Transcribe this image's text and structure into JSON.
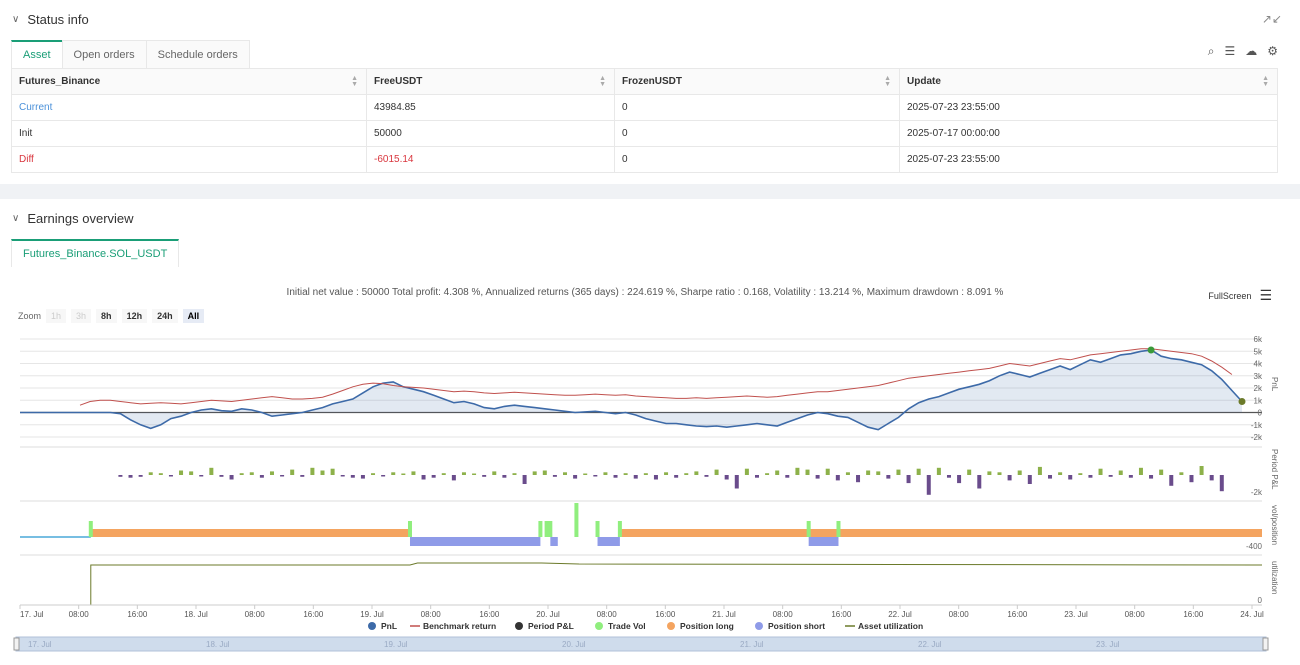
{
  "status": {
    "title": "Status info",
    "tabs": [
      "Asset",
      "Open orders",
      "Schedule orders"
    ],
    "columns": [
      "Futures_Binance",
      "FreeUSDT",
      "FrozenUSDT",
      "Update"
    ],
    "rows": [
      {
        "name": "Current",
        "free": "43984.85",
        "frozen": "0",
        "update": "2025-07-23 23:55:00"
      },
      {
        "name": "Init",
        "free": "50000",
        "frozen": "0",
        "update": "2025-07-17 00:00:00"
      },
      {
        "name": "Diff",
        "free": "-6015.14",
        "frozen": "0",
        "update": "2025-07-23 23:55:00"
      }
    ]
  },
  "earnings": {
    "title": "Earnings overview",
    "tab": "Futures_Binance.SOL_USDT",
    "summary": "Initial net value : 50000 Total profit: 4.308 %, Annualized returns (365 days) : 224.619 %, Sharpe ratio : 0.168, Volatility : 13.214 %, Maximum drawdown : 8.091 %",
    "fullscreen": "FullScreen",
    "zoom_label": "Zoom",
    "zoom_buttons": [
      "1h",
      "3h",
      "8h",
      "12h",
      "24h",
      "All"
    ]
  },
  "chart_data": {
    "type": "line",
    "y_axis_pnl": {
      "label": "PnL",
      "ticks": [
        "6k",
        "5k",
        "4k",
        "3k",
        "2k",
        "1k",
        "0",
        "-1k",
        "-2k"
      ]
    },
    "y_axis_period": {
      "label": "Period P&L",
      "ticks": [
        "-2k"
      ]
    },
    "y_axis_vol": {
      "label": "vol/position",
      "ticks": [
        "-400"
      ]
    },
    "y_axis_util": {
      "label": "utilization",
      "ticks": [
        "0"
      ]
    },
    "x_ticks": [
      "17. Jul",
      "08:00",
      "16:00",
      "18. Jul",
      "08:00",
      "16:00",
      "19. Jul",
      "08:00",
      "16:00",
      "20. Jul",
      "08:00",
      "16:00",
      "21. Jul",
      "08:00",
      "16:00",
      "22. Jul",
      "08:00",
      "16:00",
      "23. Jul",
      "08:00",
      "16:00",
      "24. Jul"
    ],
    "navigator_ticks": [
      "17. Jul",
      "18. Jul",
      "19. Jul",
      "20. Jul",
      "21. Jul",
      "22. Jul",
      "23. Jul"
    ],
    "legend": [
      {
        "name": "PnL",
        "color": "#3d6aa8"
      },
      {
        "name": "Benchmark return",
        "color": "#c0504d"
      },
      {
        "name": "Period P&L",
        "color": "#333333"
      },
      {
        "name": "Trade Vol",
        "color": "#90ee7e"
      },
      {
        "name": "Position long",
        "color": "#f4a460"
      },
      {
        "name": "Position short",
        "color": "#8f9be8"
      },
      {
        "name": "Asset utilization",
        "color": "#6b7a2a"
      }
    ],
    "pnl": [
      0,
      0,
      0,
      0,
      -100,
      -600,
      -1000,
      -1300,
      -1000,
      -500,
      -300,
      0,
      200,
      300,
      150,
      100,
      300,
      200,
      0,
      -300,
      -200,
      -100,
      0,
      200,
      400,
      700,
      900,
      1100,
      1600,
      2100,
      2400,
      2500,
      2100,
      1900,
      1700,
      1400,
      1100,
      800,
      900,
      700,
      400,
      300,
      500,
      600,
      500,
      400,
      300,
      200,
      100,
      0,
      50,
      100,
      0,
      -100,
      0,
      -200,
      -500,
      -700,
      -900,
      -900,
      -1000,
      -1100,
      -1150,
      -1100,
      -1200,
      -1100,
      -1000,
      -900,
      -1000,
      -1100,
      -800,
      -500,
      -200,
      0,
      -100,
      -300,
      -400,
      -800,
      -1200,
      -1400,
      -900,
      -400,
      300,
      800,
      1100,
      1300,
      1600,
      1900,
      2100,
      2300,
      2600,
      3000,
      3300,
      3100,
      2900,
      3200,
      3500,
      3800,
      3500,
      3900,
      4300,
      4100,
      4400,
      4700,
      4800,
      5000,
      5100,
      4600,
      4400,
      4300,
      4100,
      3900,
      3400,
      2700,
      1800,
      900
    ],
    "benchmark": [
      600,
      900,
      1000,
      1000,
      900,
      800,
      700,
      750,
      800,
      750,
      700,
      800,
      900,
      1000,
      950,
      900,
      1000,
      1100,
      1200,
      1300,
      1200,
      1100,
      1100,
      1150,
      1250,
      1500,
      1800,
      2100,
      2300,
      2400,
      2350,
      2200,
      2100,
      2050,
      2000,
      1900,
      1800,
      1700,
      1750,
      1700,
      1600,
      1550,
      1600,
      1650,
      1600,
      1550,
      1500,
      1450,
      1400,
      1400,
      1450,
      1500,
      1450,
      1400,
      1450,
      1350,
      1300,
      1250,
      1200,
      1150,
      1150,
      1200,
      1150,
      1200,
      1250,
      1300,
      1350,
      1300,
      1250,
      1300,
      1400,
      1500,
      1600,
      1700,
      1700,
      1800,
      1900,
      2000,
      2100,
      2200,
      2400,
      2600,
      2800,
      2900,
      3000,
      3100,
      3200,
      3300,
      3400,
      3500,
      3600,
      3800,
      4000,
      3900,
      3800,
      4000,
      4200,
      4400,
      4300,
      4500,
      4700,
      4800,
      4900,
      5000,
      5100,
      5200,
      5200,
      5100,
      5000,
      4900,
      4800,
      4600,
      4200,
      3700,
      3100
    ],
    "period_pnl": [
      0,
      0,
      0,
      0,
      -200,
      -300,
      -200,
      300,
      200,
      -100,
      500,
      400,
      -100,
      800,
      -200,
      -500,
      200,
      300,
      -300,
      400,
      -100,
      600,
      -200,
      800,
      500,
      700,
      -100,
      -300,
      -400,
      200,
      -100,
      300,
      100,
      400,
      -500,
      -300,
      200,
      -600,
      300,
      100,
      -200,
      400,
      -300,
      200,
      -1000,
      400,
      500,
      -200,
      300,
      -400,
      100,
      -100,
      300,
      -300,
      200,
      -400,
      200,
      -500,
      300,
      -300,
      200,
      400,
      -200,
      600,
      -500,
      -1500,
      700,
      -300,
      200,
      500,
      -300,
      800,
      600,
      -400,
      700,
      -600,
      300,
      -800,
      500,
      400,
      -400,
      600,
      -900,
      700,
      -2200,
      800,
      -300,
      -900,
      600,
      -1500,
      400,
      300,
      -600,
      500,
      -1000,
      900,
      -400,
      300,
      -500,
      200,
      -300,
      700,
      -200,
      500,
      -300,
      800,
      -400,
      600,
      -1200,
      300,
      -800,
      1000,
      -600,
      -1800
    ],
    "long_segments": [
      [
        0.057,
        0.314
      ],
      [
        0.484,
        0.635
      ],
      [
        0.636,
        1.0
      ]
    ],
    "short_segments": [
      [
        0.314,
        0.419
      ],
      [
        0.427,
        0.433
      ],
      [
        0.465,
        0.483
      ],
      [
        0.635,
        0.659
      ]
    ],
    "trade_vol_bars": [
      0.057,
      0.314,
      0.419,
      0.424,
      0.427,
      0.448,
      0.465,
      0.483,
      0.635,
      0.659
    ]
  }
}
